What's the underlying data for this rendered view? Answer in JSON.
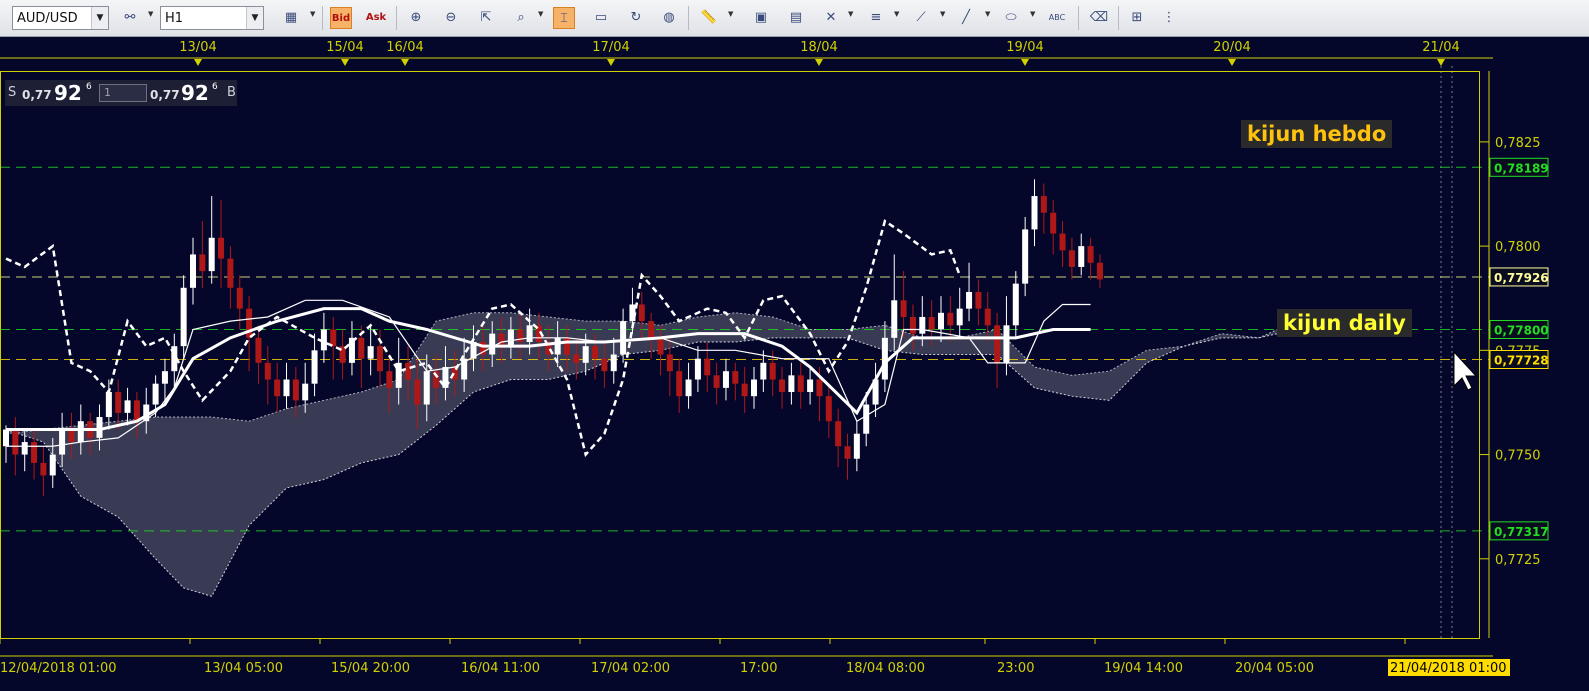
{
  "toolbar": {
    "symbol": "AUD/USD",
    "timeframe": "H1",
    "bid": "Bid",
    "ask": "Ask",
    "abc": "ABC"
  },
  "quote": {
    "sell_prefix": "S",
    "sell_small": "0,77",
    "sell_big": "92",
    "sell_sup": "6",
    "qty": "1",
    "buy_small": "0,77",
    "buy_big": "92",
    "buy_sup": "6",
    "buy_suffix": "B"
  },
  "colors": {
    "background": "#05072a",
    "frame": "#d1d100",
    "bull": "#ffffff",
    "bear": "#b01818",
    "kijun_hebdo": "#ffc20e",
    "kijun_daily": "#ffff33",
    "level_green": "#22dd22",
    "level_yellow": "#ffdd00"
  },
  "chart_data": {
    "type": "candlestick",
    "symbol": "AUD/USD",
    "timeframe": "H1",
    "top_dates": [
      "13/04",
      "15/04",
      "16/04",
      "17/04",
      "18/04",
      "19/04",
      "20/04",
      "21/04"
    ],
    "bottom_times": [
      "12/04/2018 01:00",
      "13/04 05:00",
      "15/04 20:00",
      "16/04 11:00",
      "17/04 02:00",
      "17:00",
      "18/04 08:00",
      "23:00",
      "19/04 14:00",
      "20/04 05:00",
      "21/04/2018 01:00"
    ],
    "y_ticks": [
      "0,7825",
      "0,7800",
      "0,7775",
      "0,7750",
      "0,7725"
    ],
    "ylim": [
      0.7706,
      0.7842
    ],
    "levels": [
      {
        "name": "kijun hebdo",
        "value": 0.78189,
        "label": "0,78189",
        "color": "#22dd22"
      },
      {
        "name": "kijun daily",
        "value": 0.778,
        "label": "0,77800",
        "color": "#22dd22"
      },
      {
        "name": "",
        "value": 0.77728,
        "label": "0,77728",
        "color": "#ffdd00"
      },
      {
        "name": "",
        "value": 0.77317,
        "label": "0,77317",
        "color": "#22dd22"
      },
      {
        "name": "",
        "value": 0.77926,
        "label": "0,77926",
        "color": "#ffff99"
      }
    ],
    "annotations": [
      "kijun hebdo",
      "kijun daily"
    ],
    "candles": [
      [
        0.7752,
        0.7756,
        0.7748,
        0.7757
      ],
      [
        0.7756,
        0.775,
        0.7745,
        0.7759
      ],
      [
        0.775,
        0.7753,
        0.7746,
        0.7756
      ],
      [
        0.7753,
        0.7748,
        0.7744,
        0.7756
      ],
      [
        0.7748,
        0.7745,
        0.774,
        0.7752
      ],
      [
        0.7745,
        0.775,
        0.7742,
        0.7754
      ],
      [
        0.775,
        0.7756,
        0.7747,
        0.776
      ],
      [
        0.7756,
        0.7753,
        0.7749,
        0.776
      ],
      [
        0.7753,
        0.7758,
        0.775,
        0.7762
      ],
      [
        0.7758,
        0.7754,
        0.775,
        0.776
      ],
      [
        0.7754,
        0.7759,
        0.7751,
        0.7762
      ],
      [
        0.7759,
        0.7765,
        0.7756,
        0.7768
      ],
      [
        0.7765,
        0.776,
        0.7756,
        0.7768
      ],
      [
        0.776,
        0.7763,
        0.7757,
        0.7766
      ],
      [
        0.7763,
        0.7758,
        0.7754,
        0.7765
      ],
      [
        0.7758,
        0.7762,
        0.7755,
        0.7766
      ],
      [
        0.7762,
        0.7767,
        0.7759,
        0.7769
      ],
      [
        0.7767,
        0.777,
        0.7762,
        0.7773
      ],
      [
        0.777,
        0.7776,
        0.7766,
        0.7779
      ],
      [
        0.7776,
        0.779,
        0.7773,
        0.7793
      ],
      [
        0.779,
        0.7798,
        0.7786,
        0.7802
      ],
      [
        0.7798,
        0.7794,
        0.779,
        0.7806
      ],
      [
        0.7794,
        0.7802,
        0.7791,
        0.7812
      ],
      [
        0.7802,
        0.7797,
        0.779,
        0.7811
      ],
      [
        0.7797,
        0.779,
        0.7785,
        0.78
      ],
      [
        0.779,
        0.7785,
        0.778,
        0.7793
      ],
      [
        0.7785,
        0.7778,
        0.777,
        0.7788
      ],
      [
        0.7778,
        0.7772,
        0.7767,
        0.7781
      ],
      [
        0.7772,
        0.7768,
        0.7762,
        0.7776
      ],
      [
        0.7768,
        0.7764,
        0.776,
        0.7772
      ],
      [
        0.7764,
        0.7768,
        0.7761,
        0.7772
      ],
      [
        0.7768,
        0.7763,
        0.7759,
        0.7771
      ],
      [
        0.7763,
        0.7767,
        0.776,
        0.7772
      ],
      [
        0.7767,
        0.7775,
        0.7764,
        0.7779
      ],
      [
        0.7775,
        0.778,
        0.7772,
        0.7784
      ],
      [
        0.778,
        0.7776,
        0.7768,
        0.7783
      ],
      [
        0.7776,
        0.7772,
        0.7768,
        0.778
      ],
      [
        0.7772,
        0.7778,
        0.7769,
        0.7782
      ],
      [
        0.7778,
        0.7773,
        0.7766,
        0.7781
      ],
      [
        0.7773,
        0.7776,
        0.7769,
        0.7781
      ],
      [
        0.7776,
        0.777,
        0.7766,
        0.778
      ],
      [
        0.777,
        0.7766,
        0.776,
        0.7774
      ],
      [
        0.7766,
        0.7772,
        0.7762,
        0.7778
      ],
      [
        0.7772,
        0.7768,
        0.7763,
        0.7776
      ],
      [
        0.7768,
        0.7762,
        0.7756,
        0.7773
      ],
      [
        0.7762,
        0.777,
        0.7758,
        0.7774
      ],
      [
        0.777,
        0.7766,
        0.7762,
        0.7774
      ],
      [
        0.7766,
        0.7771,
        0.7763,
        0.7776
      ],
      [
        0.7771,
        0.7768,
        0.7764,
        0.7775
      ],
      [
        0.7768,
        0.7773,
        0.7765,
        0.7778
      ],
      [
        0.7773,
        0.7777,
        0.777,
        0.7781
      ],
      [
        0.7777,
        0.7774,
        0.777,
        0.7781
      ],
      [
        0.7774,
        0.7779,
        0.7771,
        0.7782
      ],
      [
        0.7779,
        0.7776,
        0.7772,
        0.7783
      ],
      [
        0.7776,
        0.778,
        0.7773,
        0.7783
      ],
      [
        0.778,
        0.7777,
        0.7773,
        0.7784
      ],
      [
        0.7777,
        0.7781,
        0.7774,
        0.7785
      ],
      [
        0.7781,
        0.7777,
        0.7773,
        0.7784
      ],
      [
        0.7777,
        0.7774,
        0.777,
        0.7781
      ],
      [
        0.7774,
        0.7778,
        0.7771,
        0.7782
      ],
      [
        0.7778,
        0.7774,
        0.777,
        0.7781
      ],
      [
        0.7774,
        0.7772,
        0.7768,
        0.7778
      ],
      [
        0.7772,
        0.7776,
        0.7769,
        0.7779
      ],
      [
        0.7776,
        0.7773,
        0.7768,
        0.7779
      ],
      [
        0.7773,
        0.777,
        0.7766,
        0.7777
      ],
      [
        0.777,
        0.7774,
        0.7767,
        0.7778
      ],
      [
        0.7774,
        0.7782,
        0.7772,
        0.7785
      ],
      [
        0.7782,
        0.7786,
        0.7779,
        0.779
      ],
      [
        0.7786,
        0.7782,
        0.7778,
        0.7789
      ],
      [
        0.7782,
        0.7778,
        0.7773,
        0.7784
      ],
      [
        0.7778,
        0.7774,
        0.7769,
        0.7781
      ],
      [
        0.7774,
        0.777,
        0.7764,
        0.7778
      ],
      [
        0.777,
        0.7764,
        0.776,
        0.7773
      ],
      [
        0.7764,
        0.7768,
        0.7761,
        0.7772
      ],
      [
        0.7768,
        0.7773,
        0.7765,
        0.7776
      ],
      [
        0.7773,
        0.7769,
        0.7765,
        0.7777
      ],
      [
        0.7769,
        0.7766,
        0.7762,
        0.7772
      ],
      [
        0.7766,
        0.777,
        0.7763,
        0.7773
      ],
      [
        0.777,
        0.7767,
        0.7763,
        0.7772
      ],
      [
        0.7767,
        0.7764,
        0.776,
        0.7771
      ],
      [
        0.7764,
        0.7768,
        0.7761,
        0.7771
      ],
      [
        0.7768,
        0.7772,
        0.7765,
        0.7775
      ],
      [
        0.7772,
        0.7768,
        0.7764,
        0.7775
      ],
      [
        0.7768,
        0.7765,
        0.7761,
        0.7771
      ],
      [
        0.7765,
        0.7769,
        0.7762,
        0.7772
      ],
      [
        0.7769,
        0.7765,
        0.7761,
        0.7772
      ],
      [
        0.7765,
        0.7768,
        0.7762,
        0.7771
      ],
      [
        0.7768,
        0.7764,
        0.7758,
        0.7771
      ],
      [
        0.7764,
        0.7758,
        0.7754,
        0.7767
      ],
      [
        0.7758,
        0.7752,
        0.7747,
        0.7761
      ],
      [
        0.7752,
        0.7749,
        0.7744,
        0.7755
      ],
      [
        0.7749,
        0.7755,
        0.7746,
        0.7758
      ],
      [
        0.7755,
        0.7762,
        0.7752,
        0.7765
      ],
      [
        0.7762,
        0.7768,
        0.7759,
        0.7772
      ],
      [
        0.7768,
        0.7778,
        0.7765,
        0.7782
      ],
      [
        0.7778,
        0.7787,
        0.7775,
        0.7798
      ],
      [
        0.7787,
        0.7783,
        0.7778,
        0.7794
      ],
      [
        0.7783,
        0.7779,
        0.7775,
        0.7786
      ],
      [
        0.7779,
        0.7783,
        0.7776,
        0.7788
      ],
      [
        0.7783,
        0.778,
        0.7776,
        0.7787
      ],
      [
        0.778,
        0.7784,
        0.7777,
        0.7788
      ],
      [
        0.7784,
        0.7781,
        0.7777,
        0.7788
      ],
      [
        0.7781,
        0.7785,
        0.7778,
        0.779
      ],
      [
        0.7785,
        0.7789,
        0.7782,
        0.7796
      ],
      [
        0.7789,
        0.7785,
        0.7781,
        0.7792
      ],
      [
        0.7785,
        0.7781,
        0.7777,
        0.7789
      ],
      [
        0.7781,
        0.7772,
        0.7766,
        0.7784
      ],
      [
        0.7772,
        0.7781,
        0.7769,
        0.7788
      ],
      [
        0.7781,
        0.7791,
        0.7778,
        0.7794
      ],
      [
        0.7791,
        0.7804,
        0.7788,
        0.7807
      ],
      [
        0.7804,
        0.7812,
        0.78,
        0.7816
      ],
      [
        0.7812,
        0.7808,
        0.7803,
        0.7815
      ],
      [
        0.7808,
        0.7803,
        0.7798,
        0.7811
      ],
      [
        0.7803,
        0.7799,
        0.7795,
        0.7806
      ],
      [
        0.7799,
        0.7795,
        0.7792,
        0.7802
      ],
      [
        0.7795,
        0.78,
        0.7793,
        0.7803
      ],
      [
        0.78,
        0.7796,
        0.7792,
        0.7802
      ],
      [
        0.7796,
        0.7792,
        0.779,
        0.7798
      ]
    ],
    "tenkan": [
      [
        0,
        0.7752
      ],
      [
        3,
        0.7752
      ],
      [
        5,
        0.7752
      ],
      [
        8,
        0.7753
      ],
      [
        12,
        0.7754
      ],
      [
        16,
        0.776
      ],
      [
        18,
        0.7766
      ],
      [
        20,
        0.778
      ],
      [
        24,
        0.7782
      ],
      [
        28,
        0.7783
      ],
      [
        32,
        0.7787
      ],
      [
        36,
        0.7787
      ],
      [
        41,
        0.7783
      ],
      [
        45,
        0.777
      ],
      [
        48,
        0.7771
      ],
      [
        53,
        0.7777
      ],
      [
        56,
        0.7778
      ],
      [
        60,
        0.7778
      ],
      [
        64,
        0.7777
      ],
      [
        70,
        0.7778
      ],
      [
        74,
        0.7775
      ],
      [
        78,
        0.7775
      ],
      [
        83,
        0.7773
      ],
      [
        88,
        0.7773
      ],
      [
        91,
        0.7758
      ],
      [
        94,
        0.7762
      ],
      [
        96,
        0.778
      ],
      [
        98,
        0.778
      ],
      [
        103,
        0.7778
      ],
      [
        105,
        0.7772
      ],
      [
        109,
        0.7772
      ],
      [
        111,
        0.7782
      ],
      [
        113,
        0.7786
      ],
      [
        116,
        0.7786
      ]
    ],
    "kijun": [
      [
        0,
        0.7756
      ],
      [
        10,
        0.7756
      ],
      [
        14,
        0.7758
      ],
      [
        17,
        0.7762
      ],
      [
        20,
        0.7773
      ],
      [
        24,
        0.7778
      ],
      [
        29,
        0.7782
      ],
      [
        34,
        0.7785
      ],
      [
        38,
        0.7785
      ],
      [
        41,
        0.7782
      ],
      [
        45,
        0.778
      ],
      [
        51,
        0.7776
      ],
      [
        56,
        0.7776
      ],
      [
        60,
        0.7777
      ],
      [
        64,
        0.7777
      ],
      [
        70,
        0.7778
      ],
      [
        74,
        0.7779
      ],
      [
        79,
        0.7779
      ],
      [
        83,
        0.7776
      ],
      [
        86,
        0.7771
      ],
      [
        91,
        0.776
      ],
      [
        94,
        0.7772
      ],
      [
        97,
        0.7778
      ],
      [
        103,
        0.7778
      ],
      [
        108,
        0.7778
      ],
      [
        112,
        0.778
      ],
      [
        116,
        0.778
      ]
    ],
    "chikou": [
      [
        0,
        0.7797
      ],
      [
        2,
        0.7795
      ],
      [
        5,
        0.78
      ],
      [
        7,
        0.7772
      ],
      [
        9,
        0.777
      ],
      [
        11,
        0.7765
      ],
      [
        13,
        0.7782
      ],
      [
        15,
        0.7776
      ],
      [
        17,
        0.7778
      ],
      [
        19,
        0.777
      ],
      [
        21,
        0.7763
      ],
      [
        24,
        0.777
      ],
      [
        26,
        0.7778
      ],
      [
        29,
        0.7783
      ],
      [
        33,
        0.7778
      ],
      [
        36,
        0.7775
      ],
      [
        39,
        0.7781
      ],
      [
        42,
        0.777
      ],
      [
        45,
        0.7772
      ],
      [
        47,
        0.7766
      ],
      [
        49,
        0.7774
      ],
      [
        52,
        0.7785
      ],
      [
        54,
        0.7786
      ],
      [
        57,
        0.778
      ],
      [
        60,
        0.7768
      ],
      [
        62,
        0.775
      ],
      [
        64,
        0.7755
      ],
      [
        66,
        0.7768
      ],
      [
        68,
        0.7793
      ],
      [
        70,
        0.7788
      ],
      [
        72,
        0.7782
      ],
      [
        75,
        0.7785
      ],
      [
        77,
        0.7784
      ],
      [
        79,
        0.7778
      ],
      [
        81,
        0.7787
      ],
      [
        83,
        0.7788
      ],
      [
        86,
        0.7779
      ],
      [
        88,
        0.777
      ],
      [
        90,
        0.7777
      ],
      [
        92,
        0.779
      ],
      [
        94,
        0.7806
      ],
      [
        96,
        0.7803
      ],
      [
        99,
        0.7798
      ],
      [
        101,
        0.7799
      ],
      [
        102,
        0.7793
      ]
    ],
    "cloud_x": [
      0,
      4,
      8,
      12,
      16,
      19,
      22,
      26,
      30,
      34,
      38,
      42,
      46,
      50,
      54,
      58,
      62,
      66,
      70,
      74,
      78,
      82,
      86,
      90,
      94,
      98,
      102,
      106,
      110,
      114,
      118,
      122,
      126,
      130,
      134,
      138,
      140
    ],
    "senkou_a": [
      0.7755,
      0.7756,
      0.7757,
      0.7758,
      0.7759,
      0.7759,
      0.7759,
      0.7758,
      0.7761,
      0.7763,
      0.7765,
      0.7768,
      0.7782,
      0.7784,
      0.7784,
      0.7783,
      0.7782,
      0.7782,
      0.7781,
      0.7783,
      0.7784,
      0.7783,
      0.778,
      0.778,
      0.7781,
      0.7778,
      0.7778,
      0.778,
      0.7771,
      0.7769,
      0.777,
      0.7775,
      0.7776,
      0.7779,
      0.7778,
      0.7782,
      0.7782
    ],
    "senkou_b": [
      0.7756,
      0.7753,
      0.774,
      0.7735,
      0.7725,
      0.7718,
      0.7716,
      0.7733,
      0.7742,
      0.7744,
      0.7748,
      0.775,
      0.7757,
      0.7765,
      0.7768,
      0.7768,
      0.777,
      0.7774,
      0.7775,
      0.7777,
      0.7777,
      0.7778,
      0.7778,
      0.7778,
      0.7775,
      0.7774,
      0.7774,
      0.7774,
      0.7766,
      0.7764,
      0.7763,
      0.7772,
      0.7776,
      0.7778,
      0.7778,
      0.778,
      0.778
    ]
  }
}
